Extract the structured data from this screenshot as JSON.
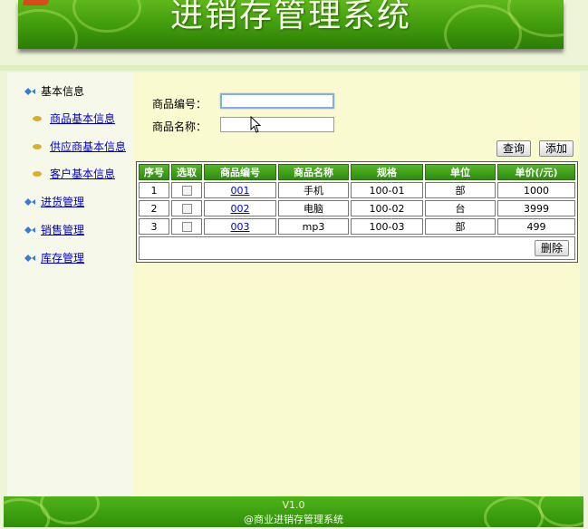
{
  "header": {
    "title": "进销存管理系统"
  },
  "sidebar": {
    "basic": "基本信息",
    "sub": [
      "商品基本信息",
      "供应商基本信息",
      "客户基本信息"
    ],
    "purchase": "进货管理",
    "sales": "销售管理",
    "stock": "库存管理"
  },
  "form": {
    "code_label": "商品编号：",
    "name_label": "商品名称：",
    "code_value": "",
    "name_value": ""
  },
  "buttons": {
    "query": "查询",
    "add": "添加",
    "delete": "删除"
  },
  "table": {
    "headers": [
      "序号",
      "选取",
      "商品编号",
      "商品名称",
      "规格",
      "单位",
      "单价(/元)"
    ],
    "rows": [
      {
        "no": "1",
        "code": "001",
        "name": "手机",
        "spec": "100-01",
        "unit": "部",
        "price": "1000"
      },
      {
        "no": "2",
        "code": "002",
        "name": "电脑",
        "spec": "100-02",
        "unit": "台",
        "price": "3999"
      },
      {
        "no": "3",
        "code": "003",
        "name": "mp3",
        "spec": "100-03",
        "unit": "部",
        "price": "499"
      }
    ]
  },
  "footer": {
    "version": "V1.0",
    "copyright": "@商业进销存管理系统"
  },
  "colors": {
    "banner": "#3f9a0d",
    "header_cell": "#3a9d18",
    "main_bg": "#fafad0",
    "link": "#0000cc"
  },
  "icons": {
    "nav": "fish-icon",
    "sub": "bullet-icon",
    "pointer": "cursor-icon"
  }
}
